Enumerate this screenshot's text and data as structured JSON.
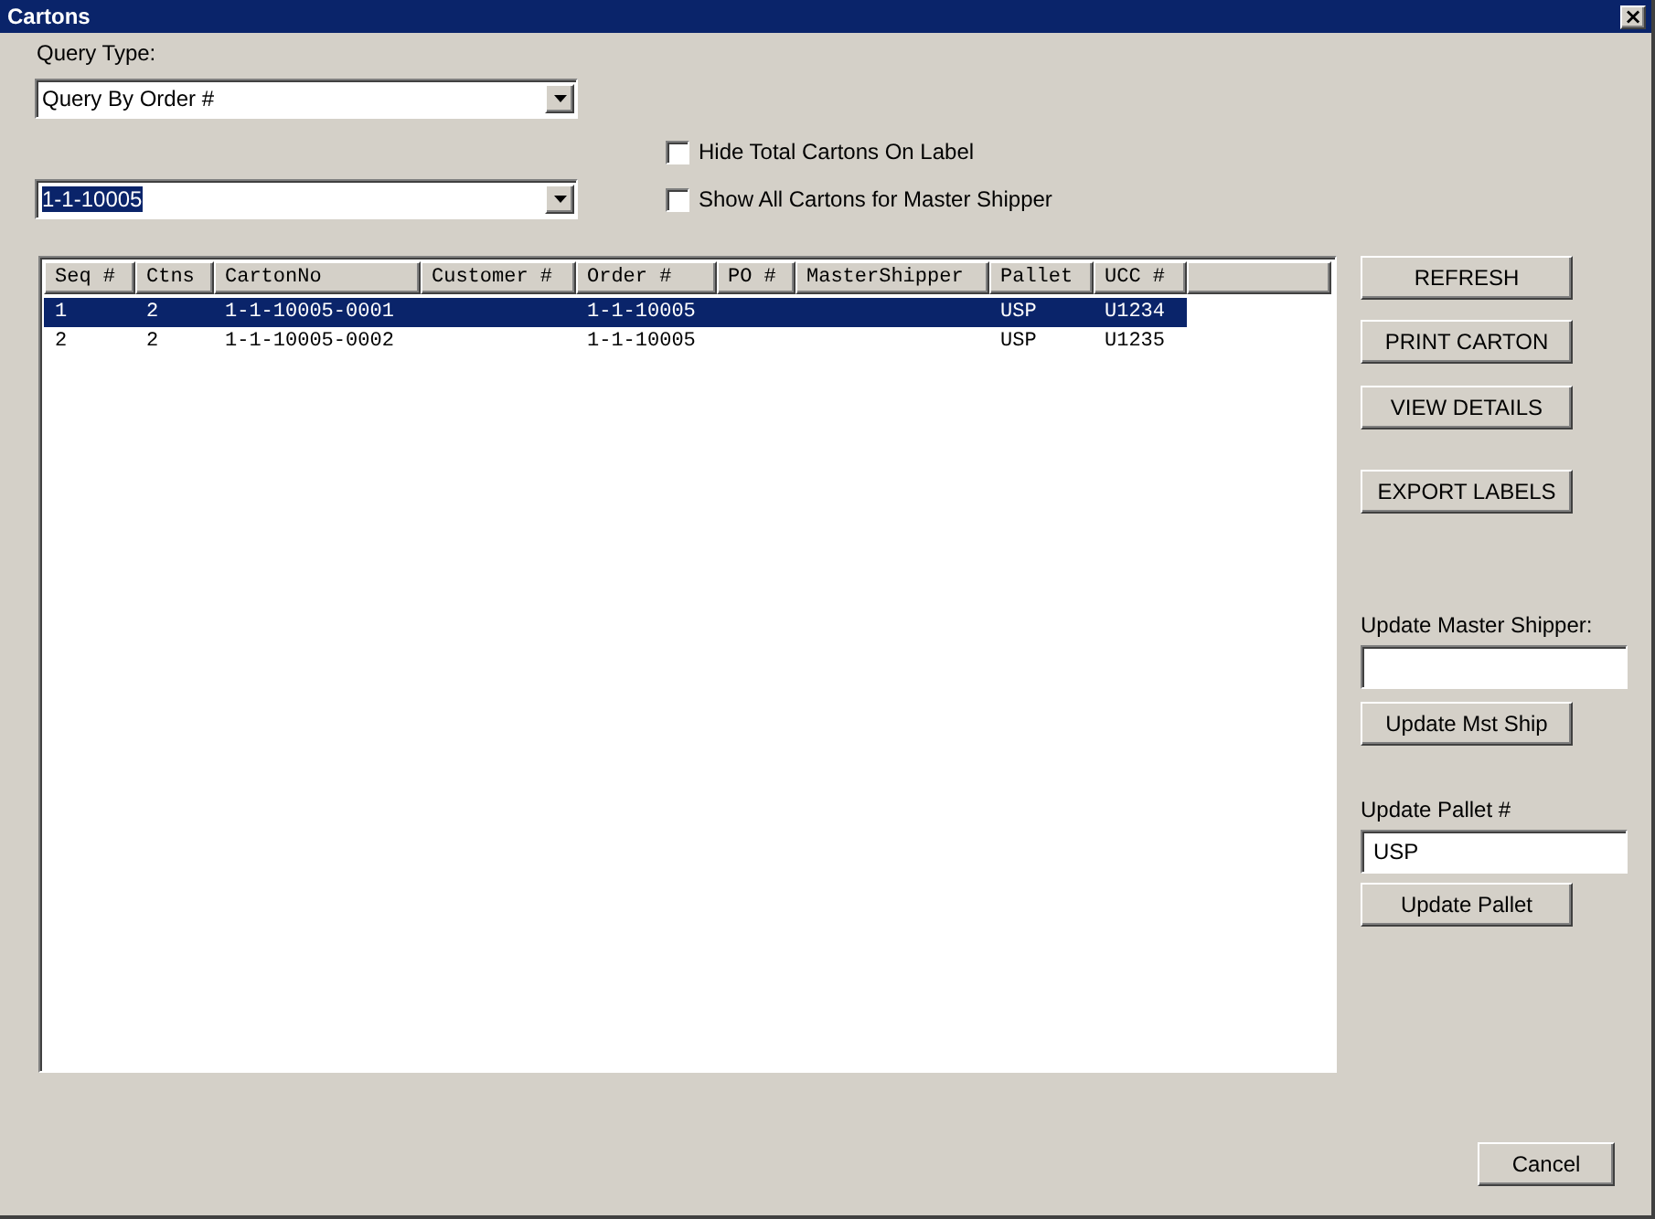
{
  "window": {
    "title": "Cartons",
    "close": "×"
  },
  "query_type": {
    "label": "Query Type:",
    "value": "Query By Order #"
  },
  "order_combo": {
    "value": "1-1-10005",
    "text_selected": true
  },
  "options": [
    {
      "label": "Hide Total Cartons On Label",
      "checked": false
    },
    {
      "label": "Show All Cartons for Master Shipper",
      "checked": false
    }
  ],
  "table": {
    "columns": [
      "Seq #",
      "Ctns",
      "CartonNo",
      "Customer #",
      "Order #",
      "PO #",
      "MasterShipper",
      "Pallet",
      "UCC #"
    ],
    "rows": [
      {
        "cells": [
          "1",
          "2",
          "1-1-10005-0001",
          "",
          "1-1-10005",
          "",
          "",
          "USP",
          "U1234"
        ],
        "selected": true
      },
      {
        "cells": [
          "2",
          "2",
          "1-1-10005-0002",
          "",
          "1-1-10005",
          "",
          "",
          "USP",
          "U1235"
        ],
        "selected": false
      }
    ]
  },
  "actions": [
    "REFRESH",
    "PRINT CARTON",
    "VIEW DETAILS",
    "EXPORT LABELS"
  ],
  "master_shipper": {
    "label": "Update Master Shipper:",
    "button": "Update Mst Ship"
  },
  "pallet": {
    "label": "Update Pallet #",
    "value": "USP",
    "button": "Update Pallet"
  },
  "cancel": "Cancel"
}
